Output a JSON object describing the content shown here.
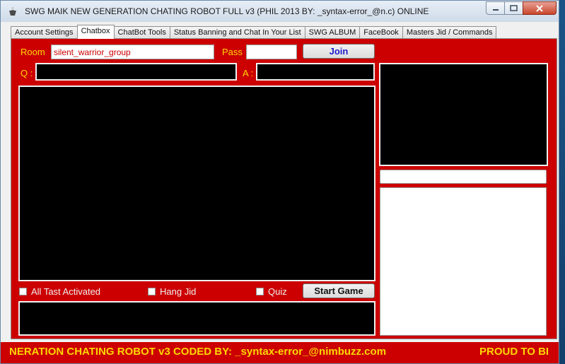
{
  "window": {
    "title": "SWG MAIK NEW GENERATION CHATING ROBOT FULL v3 (PHIL 2013 BY: _syntax-error_@n.c)   ONLINE",
    "min_icon": "minimize-icon",
    "max_icon": "maximize-icon",
    "close_icon": "close-icon"
  },
  "tabs": [
    {
      "label": "Account Settings"
    },
    {
      "label": "Chatbox"
    },
    {
      "label": "ChatBot Tools"
    },
    {
      "label": "Status Banning and Chat In Your List"
    },
    {
      "label": "SWG ALBUM"
    },
    {
      "label": "FaceBook"
    },
    {
      "label": "Masters Jid / Commands"
    }
  ],
  "chatbox": {
    "room_label": "Room",
    "room_value": "silent_warrior_group",
    "pass_label": "Pass",
    "pass_value": "",
    "join_label": "Join",
    "q_label": "Q :",
    "a_label": "A :",
    "checkboxes": [
      {
        "label": "All Tast Activated",
        "checked": false
      },
      {
        "label": "Hang Jid",
        "checked": false
      },
      {
        "label": "Quiz",
        "checked": false
      }
    ],
    "start_game_label": "Start Game"
  },
  "marquee": {
    "text_left": "NERATION CHATING ROBOT v3  CODED BY: _syntax-error_@nimbuzz.com",
    "text_right": "PROUD TO BI"
  },
  "colors": {
    "panel": "#cc0000",
    "label": "#ffd700",
    "join": "#1a1acc"
  }
}
